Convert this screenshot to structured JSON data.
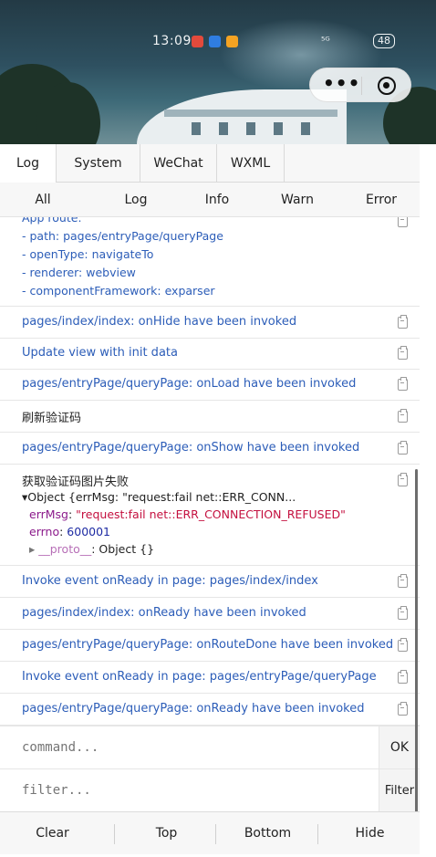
{
  "status_bar": {
    "time": "13:09",
    "signal": "⁵ᴳ",
    "battery": "48"
  },
  "capsule": {
    "more_icon": "more-dots-icon",
    "close_icon": "target-circle-icon"
  },
  "tabs": [
    {
      "label": "Log",
      "active": true
    },
    {
      "label": "System"
    },
    {
      "label": "WeChat"
    },
    {
      "label": "WXML"
    }
  ],
  "filters": [
    {
      "label": "All",
      "active": true
    },
    {
      "label": "Log"
    },
    {
      "label": "Info"
    },
    {
      "label": "Warn"
    },
    {
      "label": "Error"
    }
  ],
  "route_entry": {
    "title": "App route:",
    "lines": [
      "- path: pages/entryPage/queryPage",
      "- openType: navigateTo",
      "- renderer: webview",
      "- componentFramework: exparser"
    ]
  },
  "logs": [
    {
      "text": "pages/index/index: onHide have been invoked",
      "color": "#2c5db8"
    },
    {
      "text": "Update view with init data",
      "color": "#2c5db8"
    },
    {
      "text": "pages/entryPage/queryPage: onLoad have been invoked",
      "color": "#2c5db8"
    },
    {
      "text": "刷新验证码",
      "color": "#222222"
    },
    {
      "text": "pages/entryPage/queryPage: onShow have been invoked",
      "color": "#2c5db8"
    }
  ],
  "error_entry": {
    "title": "获取验证码图片失败",
    "summary": "▾Object {errMsg: \"request:fail net::ERR_CONN...",
    "errMsg_key": "errMsg",
    "errMsg_value": "\"request:fail net::ERR_CONNECTION_REFUSED\"",
    "errno_key": "errno",
    "errno_value": "600001",
    "proto_key": "__proto__",
    "proto_value": ": Object {}"
  },
  "logs_after": [
    {
      "text": "Invoke event onReady in page: pages/index/index",
      "color": "#2c5db8"
    },
    {
      "text": "pages/index/index: onReady have been invoked",
      "color": "#2c5db8"
    },
    {
      "text": "pages/entryPage/queryPage: onRouteDone have been invoked",
      "color": "#2c5db8"
    },
    {
      "text": "Invoke event onReady in page: pages/entryPage/queryPage",
      "color": "#2c5db8"
    },
    {
      "text": "pages/entryPage/queryPage: onReady have been invoked",
      "color": "#2c5db8"
    }
  ],
  "command": {
    "placeholder": "command...",
    "button": "OK"
  },
  "filter": {
    "placeholder": "filter...",
    "button": "Filter"
  },
  "bottom_bar": [
    "Clear",
    "Top",
    "Bottom",
    "Hide"
  ]
}
